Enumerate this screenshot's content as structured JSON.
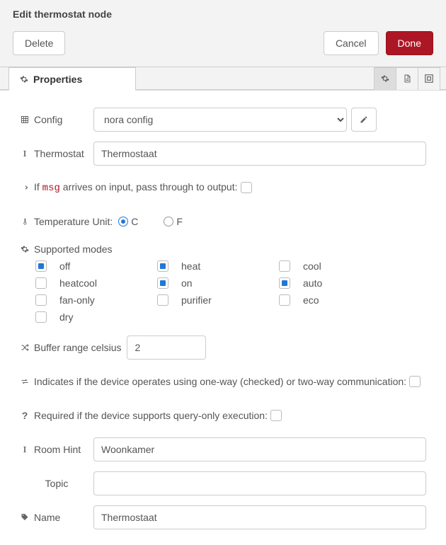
{
  "title": "Edit thermostat node",
  "actions": {
    "delete": "Delete",
    "cancel": "Cancel",
    "done": "Done"
  },
  "tabs": {
    "properties": "Properties"
  },
  "form": {
    "config_label": "Config",
    "config_value": "nora config",
    "thermostat_label": "Thermostat",
    "thermostat_value": "Thermostaat",
    "passthrough_prefix": "If ",
    "passthrough_code": "msg",
    "passthrough_suffix": " arrives on input, pass through to output:",
    "passthrough_checked": false,
    "temp_unit_label": "Temperature Unit:",
    "temp_unit_c": "C",
    "temp_unit_f": "F",
    "temp_unit_selected": "C",
    "modes_label": "Supported modes",
    "modes": [
      {
        "key": "off",
        "label": "off",
        "checked": true
      },
      {
        "key": "heat",
        "label": "heat",
        "checked": true
      },
      {
        "key": "cool",
        "label": "cool",
        "checked": false
      },
      {
        "key": "heatcool",
        "label": "heatcool",
        "checked": false
      },
      {
        "key": "on",
        "label": "on",
        "checked": true
      },
      {
        "key": "auto",
        "label": "auto",
        "checked": true
      },
      {
        "key": "fan-only",
        "label": "fan-only",
        "checked": false
      },
      {
        "key": "purifier",
        "label": "purifier",
        "checked": false
      },
      {
        "key": "eco",
        "label": "eco",
        "checked": false
      },
      {
        "key": "dry",
        "label": "dry",
        "checked": false
      }
    ],
    "buffer_label": "Buffer range celsius",
    "buffer_value": "2",
    "oneway_label": "Indicates if the device operates using one-way (checked) or two-way communication:",
    "oneway_checked": false,
    "queryonly_label": "Required if the device supports query-only execution:",
    "queryonly_checked": false,
    "roomhint_label": "Room Hint",
    "roomhint_value": "Woonkamer",
    "topic_label": "Topic",
    "topic_value": "",
    "name_label": "Name",
    "name_value": "Thermostaat"
  }
}
